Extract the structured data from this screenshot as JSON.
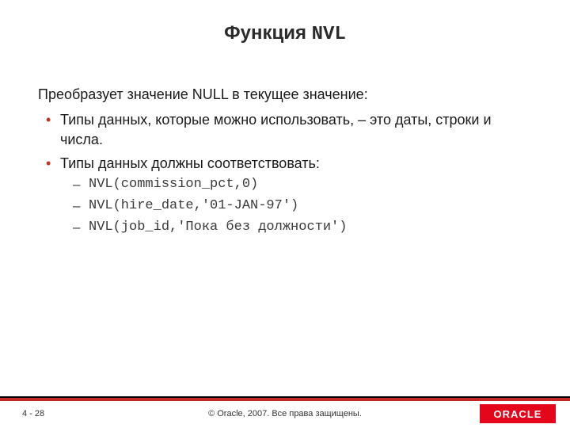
{
  "title": {
    "prefix": "Функция ",
    "code": "NVL"
  },
  "lead": "Преобразует значение NULL в текущее значение:",
  "bullets": [
    "Типы данных, которые можно использовать, – это даты, строки и числа.",
    "Типы данных должны соответствовать:"
  ],
  "examples": [
    "NVL(commission_pct,0)",
    "NVL(hire_date,'01-JAN-97')",
    "NVL(job_id,'Пока без должности')"
  ],
  "footer": {
    "page": "4 - 28",
    "copyright": "© Oracle, 2007. Все права защищены.",
    "logo_text": "ORACLE"
  }
}
